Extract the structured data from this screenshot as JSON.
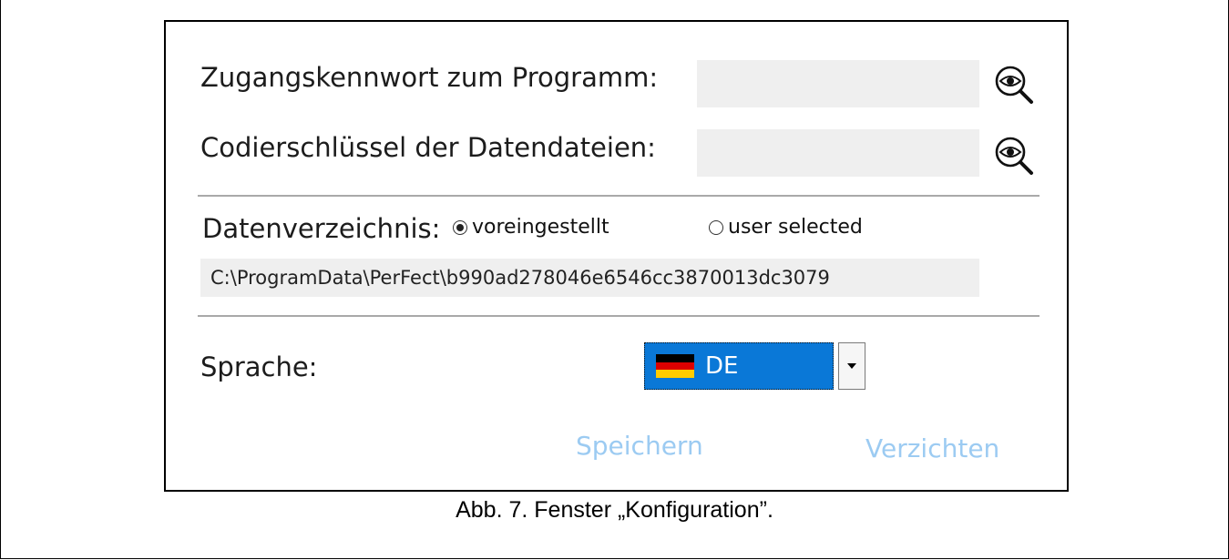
{
  "dialog": {
    "password_label": "Zugangskennwort zum Programm:",
    "password_value": "",
    "encryption_label": "Codierschlüssel der Datendateien:",
    "encryption_value": "",
    "data_dir_label": "Datenverzeichnis:",
    "radio_default_label": "voreingestellt",
    "radio_default_checked": true,
    "radio_user_label": "user selected",
    "radio_user_checked": false,
    "data_path": "C:\\ProgramData\\PerFect\\b990ad278046e6546cc3870013dc3079",
    "language_label": "Sprache:",
    "language_value": "DE",
    "flag_colors": [
      "#000000",
      "#dd0000",
      "#ffcc00"
    ],
    "save_label": "Speichern",
    "cancel_label": "Verzichten",
    "accent_color": "#0a78d7",
    "link_color": "#9ccbf2"
  },
  "caption": "Abb. 7. Fenster „Konfiguration”."
}
